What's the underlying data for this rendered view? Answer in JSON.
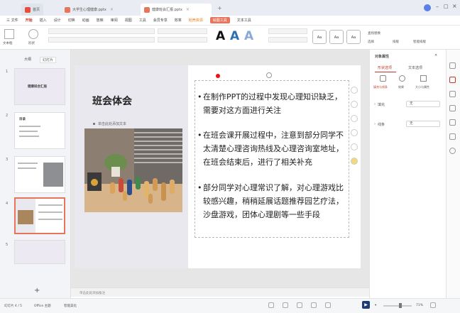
{
  "tabs": [
    {
      "label": "首页",
      "icon": "wps-home-icon",
      "color": "#e74c3c"
    },
    {
      "label": "大学生心理健康.pptx",
      "icon": "ppt-file-icon",
      "color": "#e8745a"
    },
    {
      "label": "健康班会汇报.pptx",
      "icon": "ppt-file-icon",
      "color": "#e8745a"
    }
  ],
  "menus": [
    "三 文件",
    "开始",
    "插入",
    "设计",
    "切换",
    "动画",
    "放映",
    "审阅",
    "视图",
    "工具",
    "会员专享",
    "效率",
    "稻壳资源",
    "绘图工具",
    "文本工具"
  ],
  "active_menu": "开始",
  "ribbon": {
    "buttons": [
      "文本框",
      "形状",
      "图片",
      "排列",
      "格式刷",
      "段落",
      "文本样式"
    ],
    "style_samples": [
      "Aa",
      "Aa",
      "Aa"
    ],
    "right_buttons": [
      "查找替换",
      "选择",
      "排版",
      "智能排版"
    ]
  },
  "left_panel": {
    "tabs": [
      "大纲",
      "幻灯片"
    ],
    "slides": [
      {
        "num": "1",
        "title": "健康班会汇报"
      },
      {
        "num": "2",
        "title": "目录"
      },
      {
        "num": "3",
        "title": ""
      },
      {
        "num": "4",
        "title": ""
      },
      {
        "num": "5",
        "title": ""
      }
    ],
    "add_label": "+"
  },
  "slide": {
    "title": "班会体会",
    "subtitle": "单击此处添加文本",
    "bullets": [
      "在制作PPT的过程中发现心理知识缺乏，需要对这方面进行关注",
      "在班会课开展过程中，注意到部分同学不太清楚心理咨询热线及心理咨询室地址，在班会结束后，进行了相关补充",
      "部分同学对心理常识了解，对心理游戏比较感兴趣，稍稍延展话题推荐园艺疗法，沙盘游戏，团体心理剧等一些手段"
    ]
  },
  "right_pane": {
    "title": "对象属性",
    "tabs": [
      "形状选项",
      "文本选项"
    ],
    "subtabs": [
      "填充与线条",
      "效果",
      "大小与属性"
    ],
    "rows": [
      {
        "label": "填充",
        "value": "无"
      },
      {
        "label": "线条",
        "value": "无"
      }
    ]
  },
  "notes_placeholder": "单击此处添加备注",
  "status": {
    "slide_info": "幻灯片 4 / 5",
    "theme": "Office 主题",
    "zoom_percent": "71%",
    "extra": [
      "智能美化",
      "备注",
      "批注"
    ]
  }
}
